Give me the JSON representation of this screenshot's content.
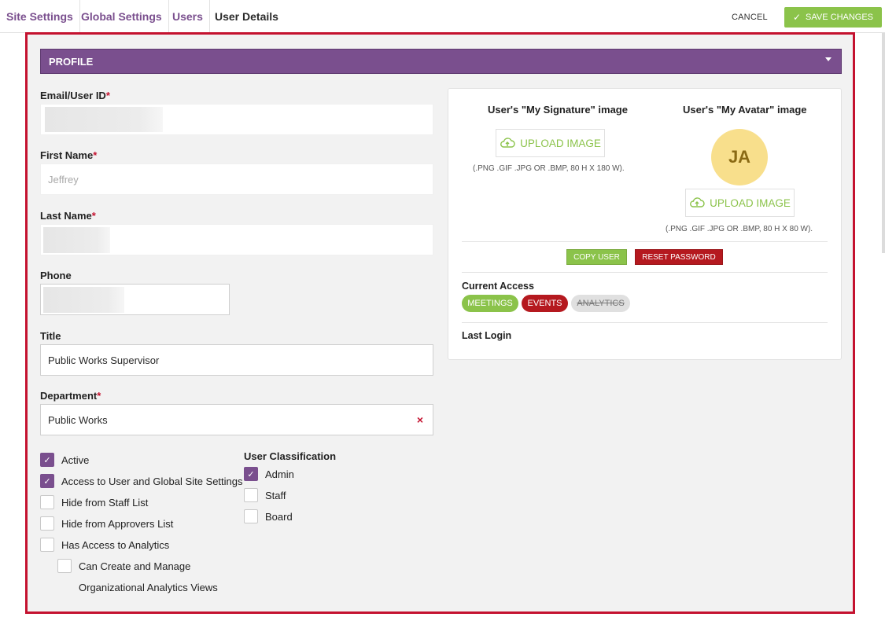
{
  "breadcrumbs": [
    "Site Settings",
    "Global Settings",
    "Users",
    "User Details"
  ],
  "header": {
    "cancel_label": "CANCEL",
    "save_label": "SAVE CHANGES"
  },
  "profile": {
    "section_title": "PROFILE"
  },
  "form": {
    "email": {
      "label": "Email/User ID",
      "required_mark": "*",
      "value": ""
    },
    "first_name": {
      "label": "First Name",
      "required_mark": "*",
      "placeholder": "Jeffrey"
    },
    "last_name": {
      "label": "Last Name",
      "required_mark": "*",
      "value": ""
    },
    "phone": {
      "label": "Phone",
      "value": ""
    },
    "title": {
      "label": "Title",
      "value": "Public Works Supervisor"
    },
    "department": {
      "label": "Department",
      "required_mark": "*",
      "value": "Public Works",
      "clear_icon": "×"
    }
  },
  "options": [
    {
      "label": "Active",
      "checked": true
    },
    {
      "label": "Access to User and Global Site Settings",
      "checked": true
    },
    {
      "label": "Hide from Staff List",
      "checked": false
    },
    {
      "label": "Hide from Approvers List",
      "checked": false
    },
    {
      "label": "Has Access to Analytics",
      "checked": false
    }
  ],
  "analytics_sub": {
    "line1": "Can Create and Manage",
    "line2": "Organizational Analytics Views",
    "checked": false
  },
  "classification": {
    "title": "User Classification",
    "items": [
      {
        "label": "Admin",
        "checked": true
      },
      {
        "label": "Staff",
        "checked": false
      },
      {
        "label": "Board",
        "checked": false
      }
    ]
  },
  "images": {
    "signature": {
      "heading": "User's \"My Signature\" image",
      "button": "UPLOAD IMAGE",
      "hint": "(.PNG .GIF .JPG OR .BMP, 80 H X 180 W)."
    },
    "avatar": {
      "heading": "User's \"My Avatar\" image",
      "initials": "JA",
      "button": "UPLOAD IMAGE",
      "hint": "(.PNG .GIF .JPG OR .BMP, 80 H X 80 W)."
    }
  },
  "actions": {
    "copy_user": "COPY USER",
    "reset_password": "RESET PASSWORD"
  },
  "access": {
    "label": "Current Access",
    "pills": [
      {
        "label": "MEETINGS",
        "state": "active"
      },
      {
        "label": "EVENTS",
        "state": "active"
      },
      {
        "label": "ANALYTICS",
        "state": "disabled"
      }
    ]
  },
  "last_login": {
    "label": "Last Login"
  },
  "colors": {
    "accent_purple": "#7a4f8e",
    "success_green": "#8bc34a",
    "danger_red": "#b5191f",
    "frame_red": "#c4122f"
  },
  "icons": {
    "save": "check-icon",
    "upload": "cloud-upload-icon",
    "dropdown": "caret-down-icon",
    "clear": "close-icon"
  }
}
